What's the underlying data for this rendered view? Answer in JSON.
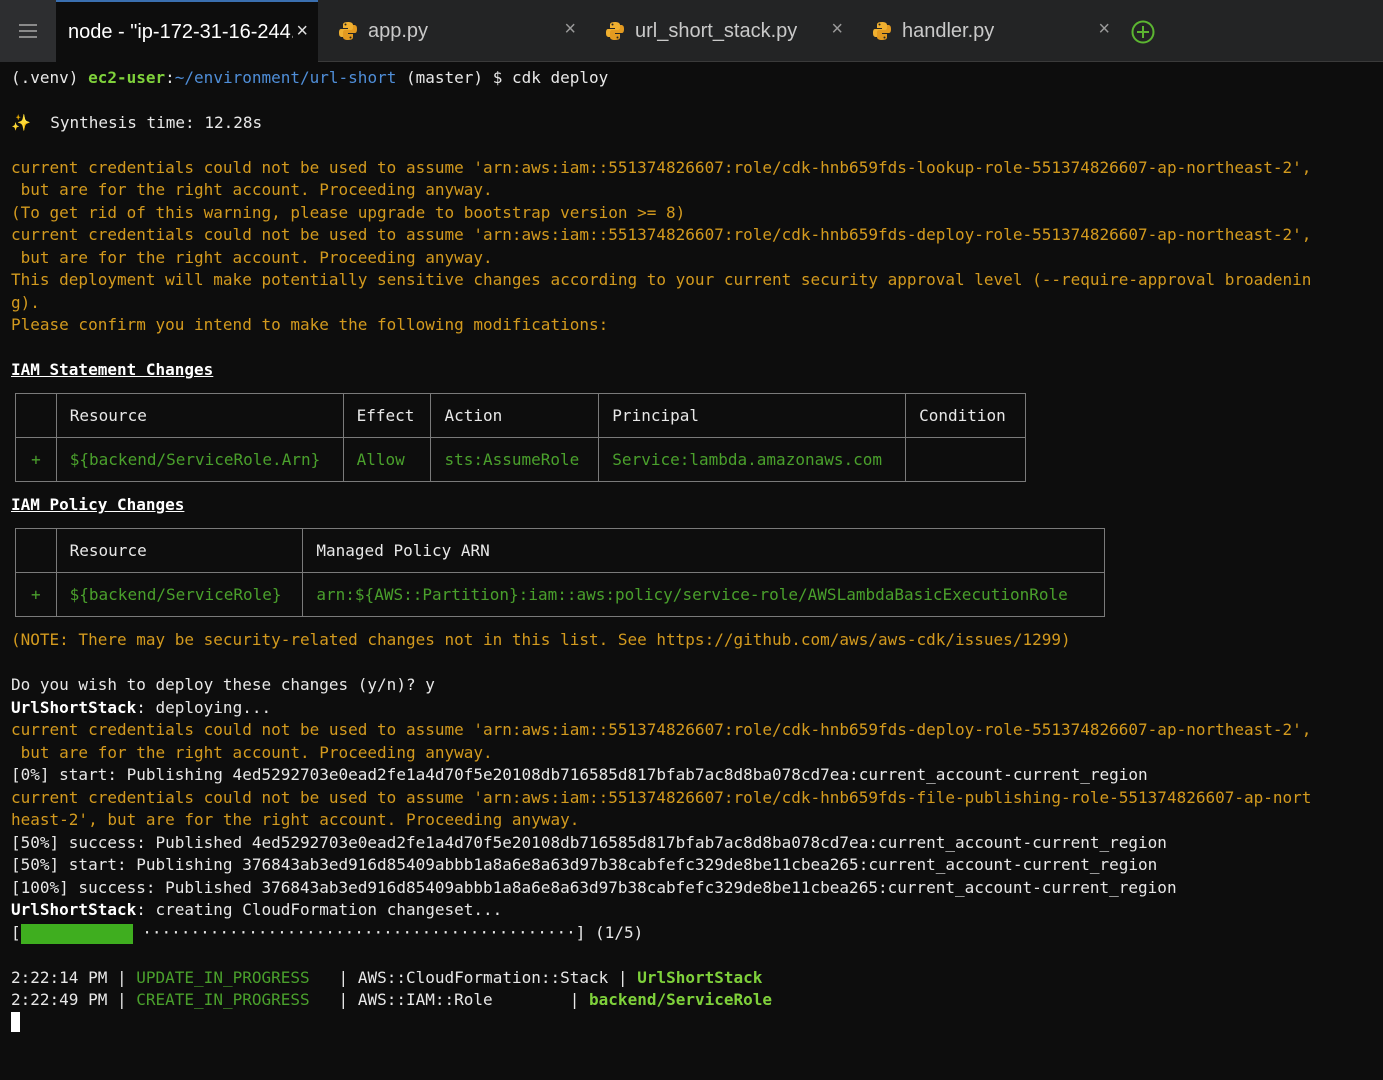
{
  "tabs": [
    {
      "label": "node - \"ip-172-31-16-244.",
      "active": true
    },
    {
      "label": "app.py"
    },
    {
      "label": "url_short_stack.py"
    },
    {
      "label": "handler.py"
    }
  ],
  "close_glyph": "×",
  "prompt": {
    "venv": "(.venv)",
    "user": "ec2-user",
    "sep": ":",
    "path": "~/environment/url-short",
    "branch": "(master)",
    "dollar": "$",
    "command": "cdk deploy"
  },
  "synthesis": {
    "icon": "✨",
    "text": "Synthesis time: 12.28s"
  },
  "warnings_1": [
    "current credentials could not be used to assume 'arn:aws:iam::551374826607:role/cdk-hnb659fds-lookup-role-551374826607-ap-northeast-2',",
    " but are for the right account. Proceeding anyway.",
    "(To get rid of this warning, please upgrade to bootstrap version >= 8)",
    "current credentials could not be used to assume 'arn:aws:iam::551374826607:role/cdk-hnb659fds-deploy-role-551374826607-ap-northeast-2',",
    " but are for the right account. Proceeding anyway.",
    "This deployment will make potentially sensitive changes according to your current security approval level (--require-approval broadenin",
    "g).",
    "Please confirm you intend to make the following modifications:"
  ],
  "iam_statement": {
    "title": "IAM Statement Changes",
    "headers": [
      "",
      "Resource",
      "Effect",
      "Action",
      "Principal",
      "Condition"
    ],
    "rows": [
      [
        "+",
        "${backend/ServiceRole.Arn}",
        "Allow",
        "sts:AssumeRole",
        "Service:lambda.amazonaws.com",
        ""
      ]
    ]
  },
  "iam_policy": {
    "title": "IAM Policy Changes",
    "headers": [
      "",
      "Resource",
      "Managed Policy ARN"
    ],
    "rows": [
      [
        "+",
        "${backend/ServiceRole}",
        "arn:${AWS::Partition}:iam::aws:policy/service-role/AWSLambdaBasicExecutionRole"
      ]
    ]
  },
  "note": "(NOTE: There may be security-related changes not in this list. See https://github.com/aws/aws-cdk/issues/1299)",
  "confirm": "Do you wish to deploy these changes (y/n)? y",
  "stack_name": "UrlShortStack",
  "deploying": ": deploying...",
  "warn_deploy": [
    "current credentials could not be used to assume 'arn:aws:iam::551374826607:role/cdk-hnb659fds-deploy-role-551374826607-ap-northeast-2',",
    " but are for the right account. Proceeding anyway."
  ],
  "publish_0": "[0%] start: Publishing 4ed5292703e0ead2fe1a4d70f5e20108db716585d817bfab7ac8d8ba078cd7ea:current_account-current_region",
  "warn_publish": [
    "current credentials could not be used to assume 'arn:aws:iam::551374826607:role/cdk-hnb659fds-file-publishing-role-551374826607-ap-nort",
    "heast-2', but are for the right account. Proceeding anyway."
  ],
  "publish_lines": [
    "[50%] success: Published 4ed5292703e0ead2fe1a4d70f5e20108db716585d817bfab7ac8d8ba078cd7ea:current_account-current_region",
    "[50%] start: Publishing 376843ab3ed916d85409abbb1a8a6e8a63d97b38cabfefc329de8be11cbea265:current_account-current_region",
    "[100%] success: Published 376843ab3ed916d85409abbb1a8a6e8a63d97b38cabfefc329de8be11cbea265:current_account-current_region"
  ],
  "changeset": ": creating CloudFormation changeset...",
  "progress": {
    "open": "[",
    "dots": "·············································",
    "close": "]",
    "count": "(1/5)",
    "fraction": 0.2
  },
  "events": [
    {
      "time": "2:22:14 PM",
      "status": "UPDATE_IN_PROGRESS",
      "type": "AWS::CloudFormation::Stack",
      "logical": "UrlShortStack"
    },
    {
      "time": "2:22:49 PM",
      "status": "CREATE_IN_PROGRESS",
      "type": "AWS::IAM::Role",
      "logical": "backend/ServiceRole"
    }
  ],
  "pipe": "|",
  "colors": {
    "warning": "#d39a1e",
    "success": "#6cc644",
    "path": "#4f8ed8",
    "progress": "#3fae1f"
  }
}
